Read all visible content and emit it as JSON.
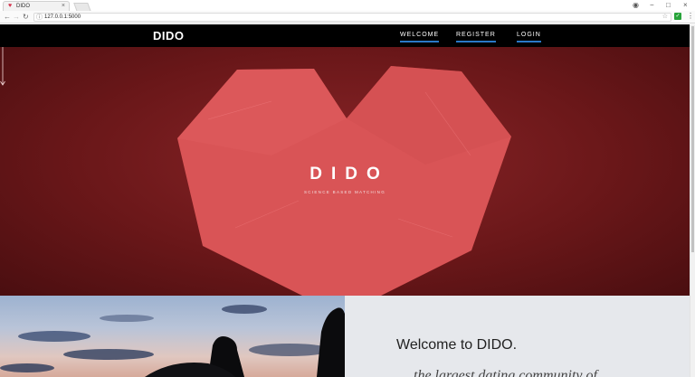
{
  "browser": {
    "tab_title": "DIDO",
    "tab_close": "×",
    "url": "127.0.0.1:5000",
    "window_controls": [
      "−",
      "□",
      "×"
    ],
    "extension_label": "✓"
  },
  "site": {
    "brand": "DIDO",
    "nav": [
      {
        "label": "WELCOME"
      },
      {
        "label": "REGISTER"
      },
      {
        "label": "LOGIN"
      }
    ],
    "accent": "#2a79c6"
  },
  "hero": {
    "title": "DIDO",
    "subtitle": "SCIENCE BASED MATCHING",
    "heart_color": "#d95456",
    "background_color": "#6a1719"
  },
  "welcome": {
    "title": "Welcome to DIDO.",
    "subtitle": "... the largest dating community of"
  }
}
